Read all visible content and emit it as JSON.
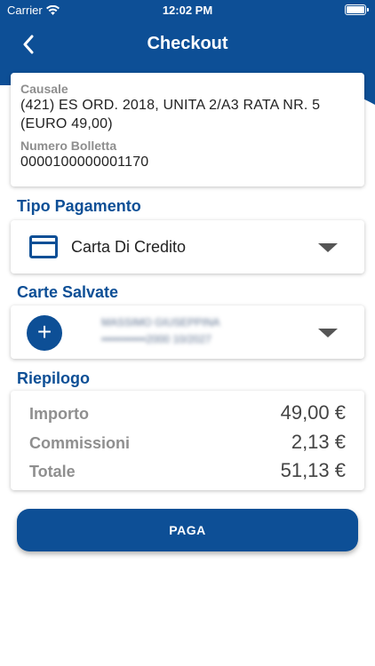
{
  "status_bar": {
    "carrier": "Carrier",
    "time": "12:02 PM"
  },
  "nav": {
    "title": "Checkout"
  },
  "details": {
    "causale_label": "Causale",
    "causale_line1": "(421) ES ORD. 2018, UNITA 2/A3 RATA NR. 5",
    "causale_line2": "(EURO 49,00)",
    "bolletta_label": "Numero Bolletta",
    "bolletta_value": "0000100000001170"
  },
  "payment_type": {
    "title": "Tipo Pagamento",
    "selected": "Carta Di Credito"
  },
  "saved_cards": {
    "title": "Carte Salvate",
    "add_icon": "+",
    "card_name": "MASSIMO GIUSEPPINA",
    "card_number": "••••••••••••2000 10/2027"
  },
  "summary": {
    "title": "Riepilogo",
    "rows": [
      {
        "label": "Importo",
        "value": "49,00 €"
      },
      {
        "label": "Commissioni",
        "value": "2,13 €"
      },
      {
        "label": "Totale",
        "value": "51,13 €"
      }
    ]
  },
  "actions": {
    "pay_label": "PAGA"
  },
  "colors": {
    "brand_blue": "#0d4f96"
  }
}
